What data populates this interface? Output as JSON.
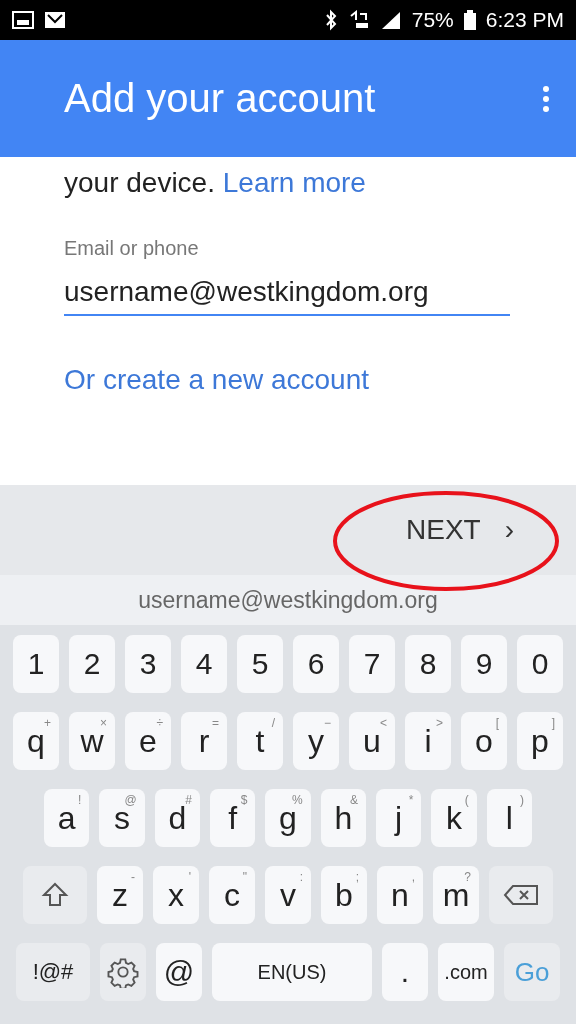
{
  "status_bar": {
    "battery_text": "75%",
    "time": "6:23 PM"
  },
  "app_bar": {
    "title": "Add your account"
  },
  "content": {
    "intro_text": "your device.",
    "learn_more": "Learn more",
    "email_field": {
      "label": "Email or phone",
      "value": "username@westkingdom.org"
    },
    "create_link": "Or create a new account"
  },
  "action_bar": {
    "next_button": "NEXT",
    "next_caret": "›",
    "highlighted": true
  },
  "suggestion": "username@westkingdom.org",
  "keyboard": {
    "number_row": {
      "keys": [
        {
          "kind": "number",
          "label": "1"
        },
        {
          "kind": "number",
          "label": "2"
        },
        {
          "kind": "number",
          "label": "3"
        },
        {
          "kind": "number",
          "label": "4"
        },
        {
          "kind": "number",
          "label": "5"
        },
        {
          "kind": "number",
          "label": "6"
        },
        {
          "kind": "number",
          "label": "7"
        },
        {
          "kind": "number",
          "label": "8"
        },
        {
          "kind": "number",
          "label": "9"
        },
        {
          "kind": "number",
          "label": "0"
        }
      ]
    },
    "top_letter_row": {
      "keys": [
        {
          "kind": "letter",
          "label": "q",
          "hint": "+"
        },
        {
          "kind": "letter",
          "label": "w",
          "hint": "×"
        },
        {
          "kind": "letter",
          "label": "e",
          "hint": "÷"
        },
        {
          "kind": "letter",
          "label": "r",
          "hint": "="
        },
        {
          "kind": "letter",
          "label": "t",
          "hint": "/"
        },
        {
          "kind": "letter",
          "label": "y",
          "hint": "−"
        },
        {
          "kind": "letter",
          "label": "u",
          "hint": "<"
        },
        {
          "kind": "letter",
          "label": "i",
          "hint": ">"
        },
        {
          "kind": "letter",
          "label": "o",
          "hint": "["
        },
        {
          "kind": "letter",
          "label": "p",
          "hint": "]"
        }
      ]
    },
    "middle_letter_row": {
      "keys": [
        {
          "kind": "letter",
          "label": "a",
          "hint": "!"
        },
        {
          "kind": "letter",
          "label": "s",
          "hint": "@"
        },
        {
          "kind": "letter",
          "label": "d",
          "hint": "#"
        },
        {
          "kind": "letter",
          "label": "f",
          "hint": "$"
        },
        {
          "kind": "letter",
          "label": "g",
          "hint": "%"
        },
        {
          "kind": "letter",
          "label": "h",
          "hint": "&"
        },
        {
          "kind": "letter",
          "label": "j",
          "hint": "*"
        },
        {
          "kind": "letter",
          "label": "k",
          "hint": "("
        },
        {
          "kind": "letter",
          "label": "l",
          "hint": ")"
        }
      ]
    },
    "bottom_letter_row": {
      "keys": [
        {
          "kind": "shift"
        },
        {
          "kind": "letter",
          "label": "z",
          "hint": "-"
        },
        {
          "kind": "letter",
          "label": "x",
          "hint": "'"
        },
        {
          "kind": "letter",
          "label": "c",
          "hint": "\""
        },
        {
          "kind": "letter",
          "label": "v",
          "hint": ":"
        },
        {
          "kind": "letter",
          "label": "b",
          "hint": ";"
        },
        {
          "kind": "letter",
          "label": "n",
          "hint": ","
        },
        {
          "kind": "letter",
          "label": "m",
          "hint": "?"
        },
        {
          "kind": "backspace"
        }
      ]
    },
    "function_row": {
      "keys": [
        {
          "kind": "symbols",
          "label": "!@#"
        },
        {
          "kind": "settings"
        },
        {
          "kind": "char",
          "label": "@"
        },
        {
          "kind": "space",
          "label": "EN(US)"
        },
        {
          "kind": "char",
          "label": "."
        },
        {
          "kind": "domain",
          "label": ".com"
        },
        {
          "kind": "go",
          "label": "Go"
        }
      ]
    }
  }
}
